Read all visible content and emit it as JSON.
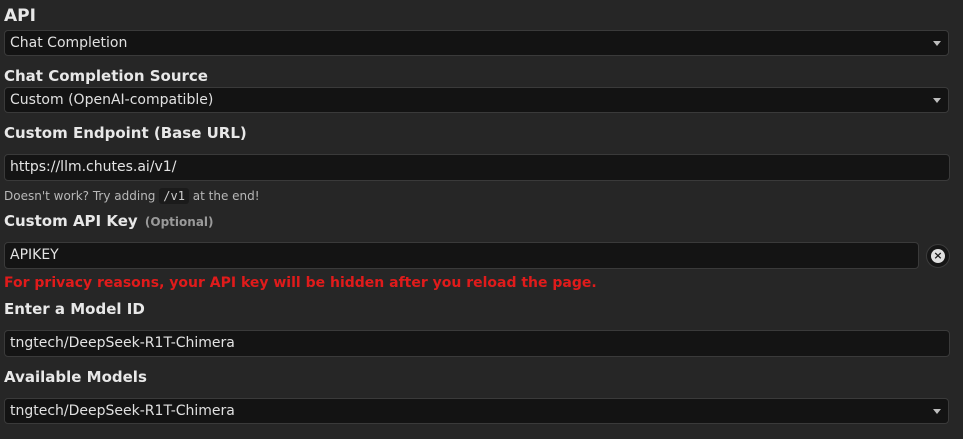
{
  "api": {
    "label": "API",
    "selected": "Chat Completion"
  },
  "source": {
    "label": "Chat Completion Source",
    "selected": "Custom (OpenAI-compatible)"
  },
  "endpoint": {
    "label": "Custom Endpoint (Base URL)",
    "value": "https://llm.chutes.ai/v1/",
    "hint_prefix": "Doesn't work? Try adding",
    "hint_code": "/v1",
    "hint_suffix": "at the end!"
  },
  "api_key": {
    "label": "Custom API Key",
    "optional_label": "(Optional)",
    "value": "APIKEY",
    "clear_icon": "close-circle-icon",
    "warning": "For privacy reasons, your API key will be hidden after you reload the page.",
    "warning_color": "#e01b1b"
  },
  "model_id": {
    "label": "Enter a Model ID",
    "value": "tngtech/DeepSeek-R1T-Chimera"
  },
  "available_models": {
    "label": "Available Models",
    "selected": "tngtech/DeepSeek-R1T-Chimera"
  }
}
